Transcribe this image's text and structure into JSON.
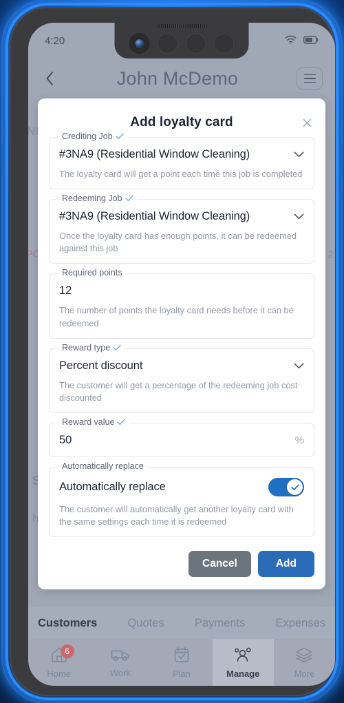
{
  "status_bar": {
    "time": "4:20",
    "wifi_icon": "wifi-icon",
    "battery_icon": "battery-icon"
  },
  "app_header": {
    "back_icon": "chevron-left-icon",
    "title": "John McDemo",
    "menu_icon": "hamburger-menu-icon"
  },
  "background_page": {
    "text_a": "NFU",
    "text_b": "PO",
    "text_c": "2",
    "text_d": "S",
    "text_e": "h"
  },
  "modal": {
    "title": "Add loyalty card",
    "close_icon": "close-icon",
    "fields": [
      {
        "label": "Crediting Job",
        "has_check": true,
        "value": "#3NA9 (Residential Window Cleaning)",
        "control": "dropdown",
        "help": "The loyalty card will get a point each time this job is completed"
      },
      {
        "label": "Redeeming Job",
        "has_check": true,
        "value": "#3NA9 (Residential Window Cleaning)",
        "control": "dropdown",
        "help": "Once the loyalty card has enough points, it can be redeemed against this job"
      },
      {
        "label": "Required points",
        "has_check": false,
        "value": "12",
        "control": "text",
        "help": "The number of points the loyalty card needs before it can be redeemed"
      },
      {
        "label": "Reward type",
        "has_check": true,
        "value": "Percent discount",
        "control": "dropdown",
        "help": "The customer will get a percentage of the redeeming job cost discounted"
      },
      {
        "label": "Reward value",
        "has_check": true,
        "value": "50",
        "control": "text-suffix",
        "suffix": "%",
        "help": ""
      },
      {
        "label": "Automatically replace",
        "has_check": false,
        "value": "Automatically replace",
        "control": "toggle",
        "toggle_on": true,
        "help": "The customer will automatically get another loyalty card with the same settings each time it is redeemed"
      }
    ],
    "cancel_label": "Cancel",
    "add_label": "Add"
  },
  "sub_tabs": [
    {
      "label": "Customers",
      "active": true
    },
    {
      "label": "Quotes",
      "active": false
    },
    {
      "label": "Payments",
      "active": false
    },
    {
      "label": "Expenses",
      "active": false
    }
  ],
  "bottom_nav": [
    {
      "label": "Home",
      "icon": "home-icon",
      "active": false,
      "badge": "6"
    },
    {
      "label": "Work",
      "icon": "truck-icon",
      "active": false,
      "badge": ""
    },
    {
      "label": "Plan",
      "icon": "calendar-icon",
      "active": false,
      "badge": ""
    },
    {
      "label": "Manage",
      "icon": "people-icon",
      "active": true,
      "badge": ""
    },
    {
      "label": "More",
      "icon": "layers-icon",
      "active": false,
      "badge": ""
    }
  ],
  "colors": {
    "accent_blue": "#2b6cb8",
    "toggle_on": "#1f6fc4",
    "cancel_gray": "#6c757d",
    "badge_red": "#c96a6a",
    "check_blue": "#74a7e6"
  }
}
